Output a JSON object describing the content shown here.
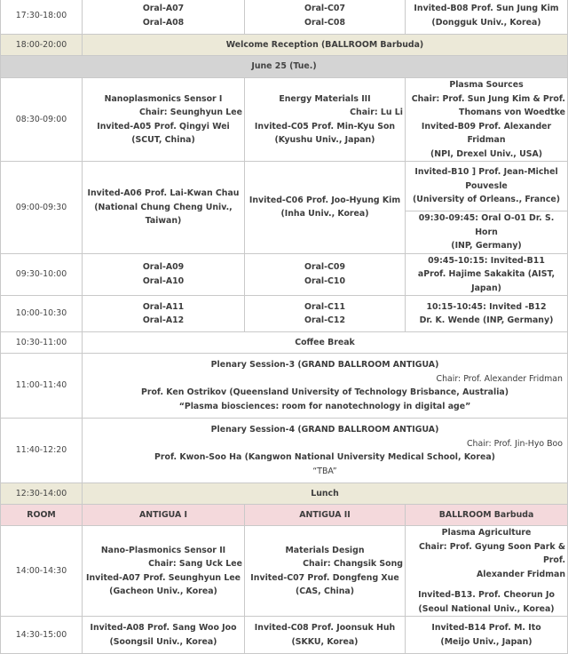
{
  "rows": {
    "r1": {
      "time": "17:30-18:00",
      "a": [
        "Oral-A07",
        "Oral-A08"
      ],
      "c": [
        "Oral-C07",
        "Oral-C08"
      ],
      "b": [
        "Invited-B08 Prof. Sun Jung Kim",
        "(Dongguk Univ., Korea)"
      ]
    },
    "r2": {
      "time": "18:00-20:00",
      "text": "Welcome Reception (BALLROOM Barbuda)"
    },
    "day": {
      "text": "June 25 (Tue.)"
    },
    "r3": {
      "time": "08:30-09:00",
      "a": {
        "session": "Nanoplasmonics Sensor I",
        "chair": "Chair: Seunghyun Lee",
        "invited": "Invited-A05 Prof. Qingyi Wei",
        "aff": "(SCUT, China)"
      },
      "c": {
        "session": "Energy Materials III",
        "chair": "Chair: Lu Li",
        "invited": "Invited-C05 Prof. Min-Kyu Son",
        "aff": "(Kyushu Univ., Japan)"
      },
      "b": {
        "session": "Plasma Sources",
        "chair1": "Chair: Prof. Sun Jung Kim & Prof.",
        "chair2": "Thomans von Woedtke",
        "invited": "Invited-B09 Prof. Alexander Fridman",
        "aff": "(NPI, Drexel Univ., USA)"
      }
    },
    "r4": {
      "time": "09:00-09:30",
      "a": [
        "Invited-A06 Prof. Lai-Kwan Chau",
        "(National Chung Cheng Univ.,",
        "Taiwan)"
      ],
      "c": [
        "Invited-C06 Prof. Joo-Hyung Kim",
        "(Inha Univ., Korea)"
      ],
      "b1": [
        "Invited-B10 ] Prof. Jean-Michel",
        "Pouvesle",
        "(University of Orleans., France)"
      ],
      "b2": [
        "09:30-09:45: Oral O-01 Dr. S. Horn",
        "(INP, Germany)"
      ]
    },
    "r5": {
      "time": "09:30-10:00",
      "a": [
        "Oral-A09",
        "Oral-A10"
      ],
      "c": [
        "Oral-C09",
        "Oral-C10"
      ],
      "b": [
        "09:45-10:15:  Invited-B11",
        "aProf. Hajime Sakakita (AIST, Japan)"
      ]
    },
    "r6": {
      "time": "10:00-10:30",
      "a": [
        "Oral-A11",
        "Oral-A12"
      ],
      "c": [
        "Oral-C11",
        "Oral-C12"
      ],
      "b": [
        "10:15-10:45:  Invited -B12",
        "Dr. K. Wende (INP, Germany)"
      ]
    },
    "r7": {
      "time": "10:30-11:00",
      "text": "Coffee Break"
    },
    "r8": {
      "time": "11:00-11:40",
      "title": "Plenary Session-3 (GRAND BALLROOM ANTIGUA)",
      "chair": "Chair: Prof. Alexander Fridman",
      "speaker": "Prof. Ken Ostrikov (Queensland University of Technology Brisbance, Australia)",
      "talk": "“Plasma biosciences: room for nanotechnology in digital age”"
    },
    "r9": {
      "time": "11:40-12:20",
      "title": "Plenary Session-4 (GRAND BALLROOM ANTIGUA)",
      "chair": "Chair: Prof. Jin-Hyo Boo",
      "speaker": "Prof. Kwon-Soo Ha (Kangwon National University Medical School, Korea)",
      "talk": "“TBA”"
    },
    "r10": {
      "time": "12:30-14:00",
      "text": "Lunch"
    },
    "rooms": {
      "room": "ROOM",
      "a": "ANTIGUA I",
      "c": "ANTIGUA II",
      "b": "BALLROOM Barbuda"
    },
    "r11": {
      "time": "14:00-14:30",
      "a": {
        "session": "Nano-Plasmonics Sensor II",
        "chair": "Chair: Sang Uck Lee",
        "invited": "Invited-A07 Prof. Seunghyun Lee",
        "aff": "(Gacheon Univ., Korea)"
      },
      "c": {
        "session": "Materials Design",
        "chair": "Chair: Changsik Song",
        "invited": "Invited-C07 Prof. Dongfeng Xue",
        "aff": "(CAS, China)"
      },
      "b": {
        "session": "Plasma Agriculture",
        "chair1": "Chair: Prof. Gyung Soon Park & Prof.",
        "chair2": "Alexander Fridman",
        "invited": "Invited-B13. Prof. Cheorun Jo",
        "aff": "(Seoul National Univ., Korea)"
      }
    },
    "r12": {
      "time": "14:30-15:00",
      "a": [
        "Invited-A08 Prof. Sang Woo Joo",
        "(Soongsil Univ., Korea)"
      ],
      "c": [
        "Invited-C08 Prof. Joonsuk Huh",
        "(SKKU, Korea)"
      ],
      "b": [
        "Invited-B14  Prof. M. Ito",
        "(Meijo Univ., Japan)"
      ]
    }
  }
}
